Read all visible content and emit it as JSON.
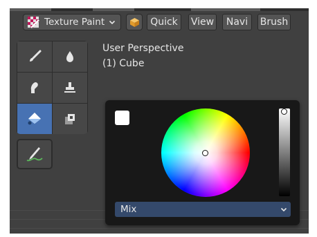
{
  "header": {
    "mode_label": "Texture Paint",
    "mode_icon": "texture-paint-icon",
    "menus": [
      {
        "label": "Quick"
      },
      {
        "label": "View"
      },
      {
        "label": "Navi"
      },
      {
        "label": "Brush"
      }
    ]
  },
  "viewport": {
    "perspective_label": "User Perspective",
    "object_label": "(1) Cube"
  },
  "toolbar": {
    "tools": [
      {
        "icon": "draw-brush-icon",
        "active": false
      },
      {
        "icon": "soften-drop-icon",
        "active": false
      },
      {
        "icon": "smear-icon",
        "active": false
      },
      {
        "icon": "clone-stamp-icon",
        "active": false
      },
      {
        "icon": "fill-bucket-icon",
        "active": true
      },
      {
        "icon": "mask-icon",
        "active": false
      }
    ],
    "extra_tool": {
      "icon": "annotate-icon"
    }
  },
  "color_popup": {
    "current_color": "#ffffff",
    "value_level": 1.0,
    "blend_mode": "Mix"
  },
  "colors": {
    "active_accent": "#4772b3",
    "select_bg": "#34496b"
  }
}
